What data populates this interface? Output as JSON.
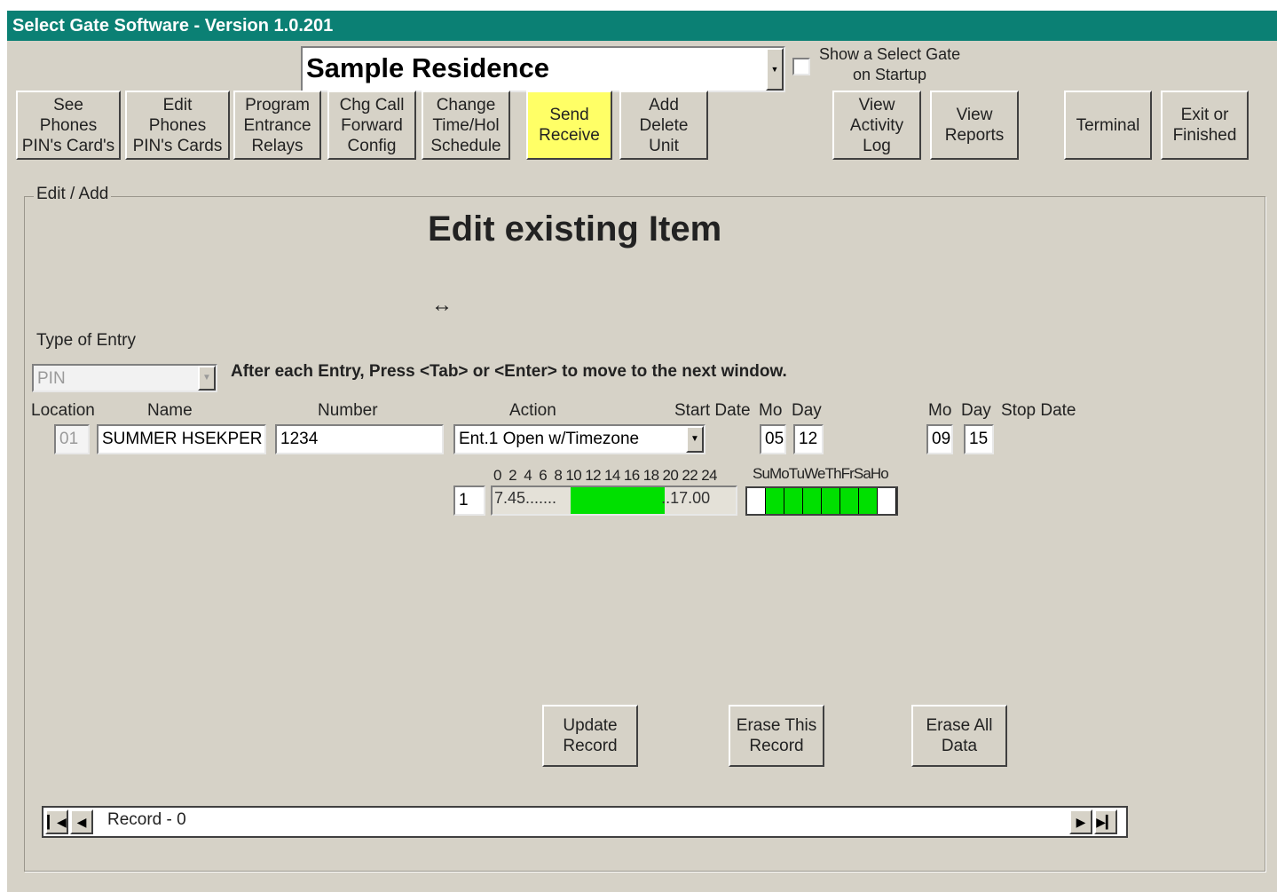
{
  "window": {
    "title": "Select Gate Software - Version 1.0.201"
  },
  "header": {
    "residence": "Sample Residence",
    "show_on_startup_label": "Show a Select Gate\non Startup"
  },
  "toolbar": [
    {
      "label": "See\nPhones\nPIN's Card's",
      "highlight": false
    },
    {
      "label": "Edit\nPhones\nPIN's Cards",
      "highlight": false
    },
    {
      "label": "Program\nEntrance\nRelays",
      "highlight": false
    },
    {
      "label": "Chg Call\nForward\nConfig",
      "highlight": false
    },
    {
      "label": "Change\nTime/Hol\nSchedule",
      "highlight": false
    },
    {
      "label": "Send\nReceive",
      "highlight": true
    },
    {
      "label": "Add\nDelete\nUnit",
      "highlight": false
    },
    {
      "label": "View\nActivity\nLog",
      "highlight": false
    },
    {
      "label": "View\nReports",
      "highlight": false
    },
    {
      "label": "Terminal",
      "highlight": false
    },
    {
      "label": "Exit or\nFinished",
      "highlight": false
    }
  ],
  "group": {
    "legend": "Edit / Add",
    "heading": "Edit existing Item",
    "resize_glyph": "↔",
    "type_label": "Type of Entry",
    "type_value": "PIN",
    "instruction": "After each Entry, Press <Tab> or <Enter> to move to the next window."
  },
  "columns": {
    "location": "Location",
    "name": "Name",
    "number": "Number",
    "action": "Action",
    "start_date": "Start Date",
    "mo": "Mo",
    "day": "Day",
    "mo2": "Mo",
    "day2": "Day",
    "stop_date": "Stop Date"
  },
  "record": {
    "location": "01",
    "name": "SUMMER HSEKPER",
    "number": "1234",
    "action": "Ent.1 Open w/Timezone",
    "start_mo": "05",
    "start_day": "12",
    "stop_mo": "09",
    "stop_day": "15"
  },
  "timezone": {
    "hours_label": "0  2  4  6  8 10 12 14 16 18 20 22 24",
    "index": "1",
    "start_time": "7.45.......",
    "end_time": "..17.00",
    "active_start_hour": 7.75,
    "active_end_hour": 17.0,
    "active_color": "#00e000",
    "days_label": "SuMoTuWeThFrSaHo",
    "days": [
      "Su",
      "Mo",
      "Tu",
      "We",
      "Th",
      "Fr",
      "Sa",
      "Ho"
    ],
    "days_active": [
      false,
      true,
      true,
      true,
      true,
      true,
      true,
      false
    ]
  },
  "buttons": {
    "update": "Update\nRecord",
    "erase_this": "Erase This\nRecord",
    "erase_all": "Erase All\nData"
  },
  "nav": {
    "record_label": "Record - 0"
  },
  "colors": {
    "titlebar": "#0b8074",
    "window_bg": "#d6d2c7",
    "highlight_button": "#ffff66"
  }
}
